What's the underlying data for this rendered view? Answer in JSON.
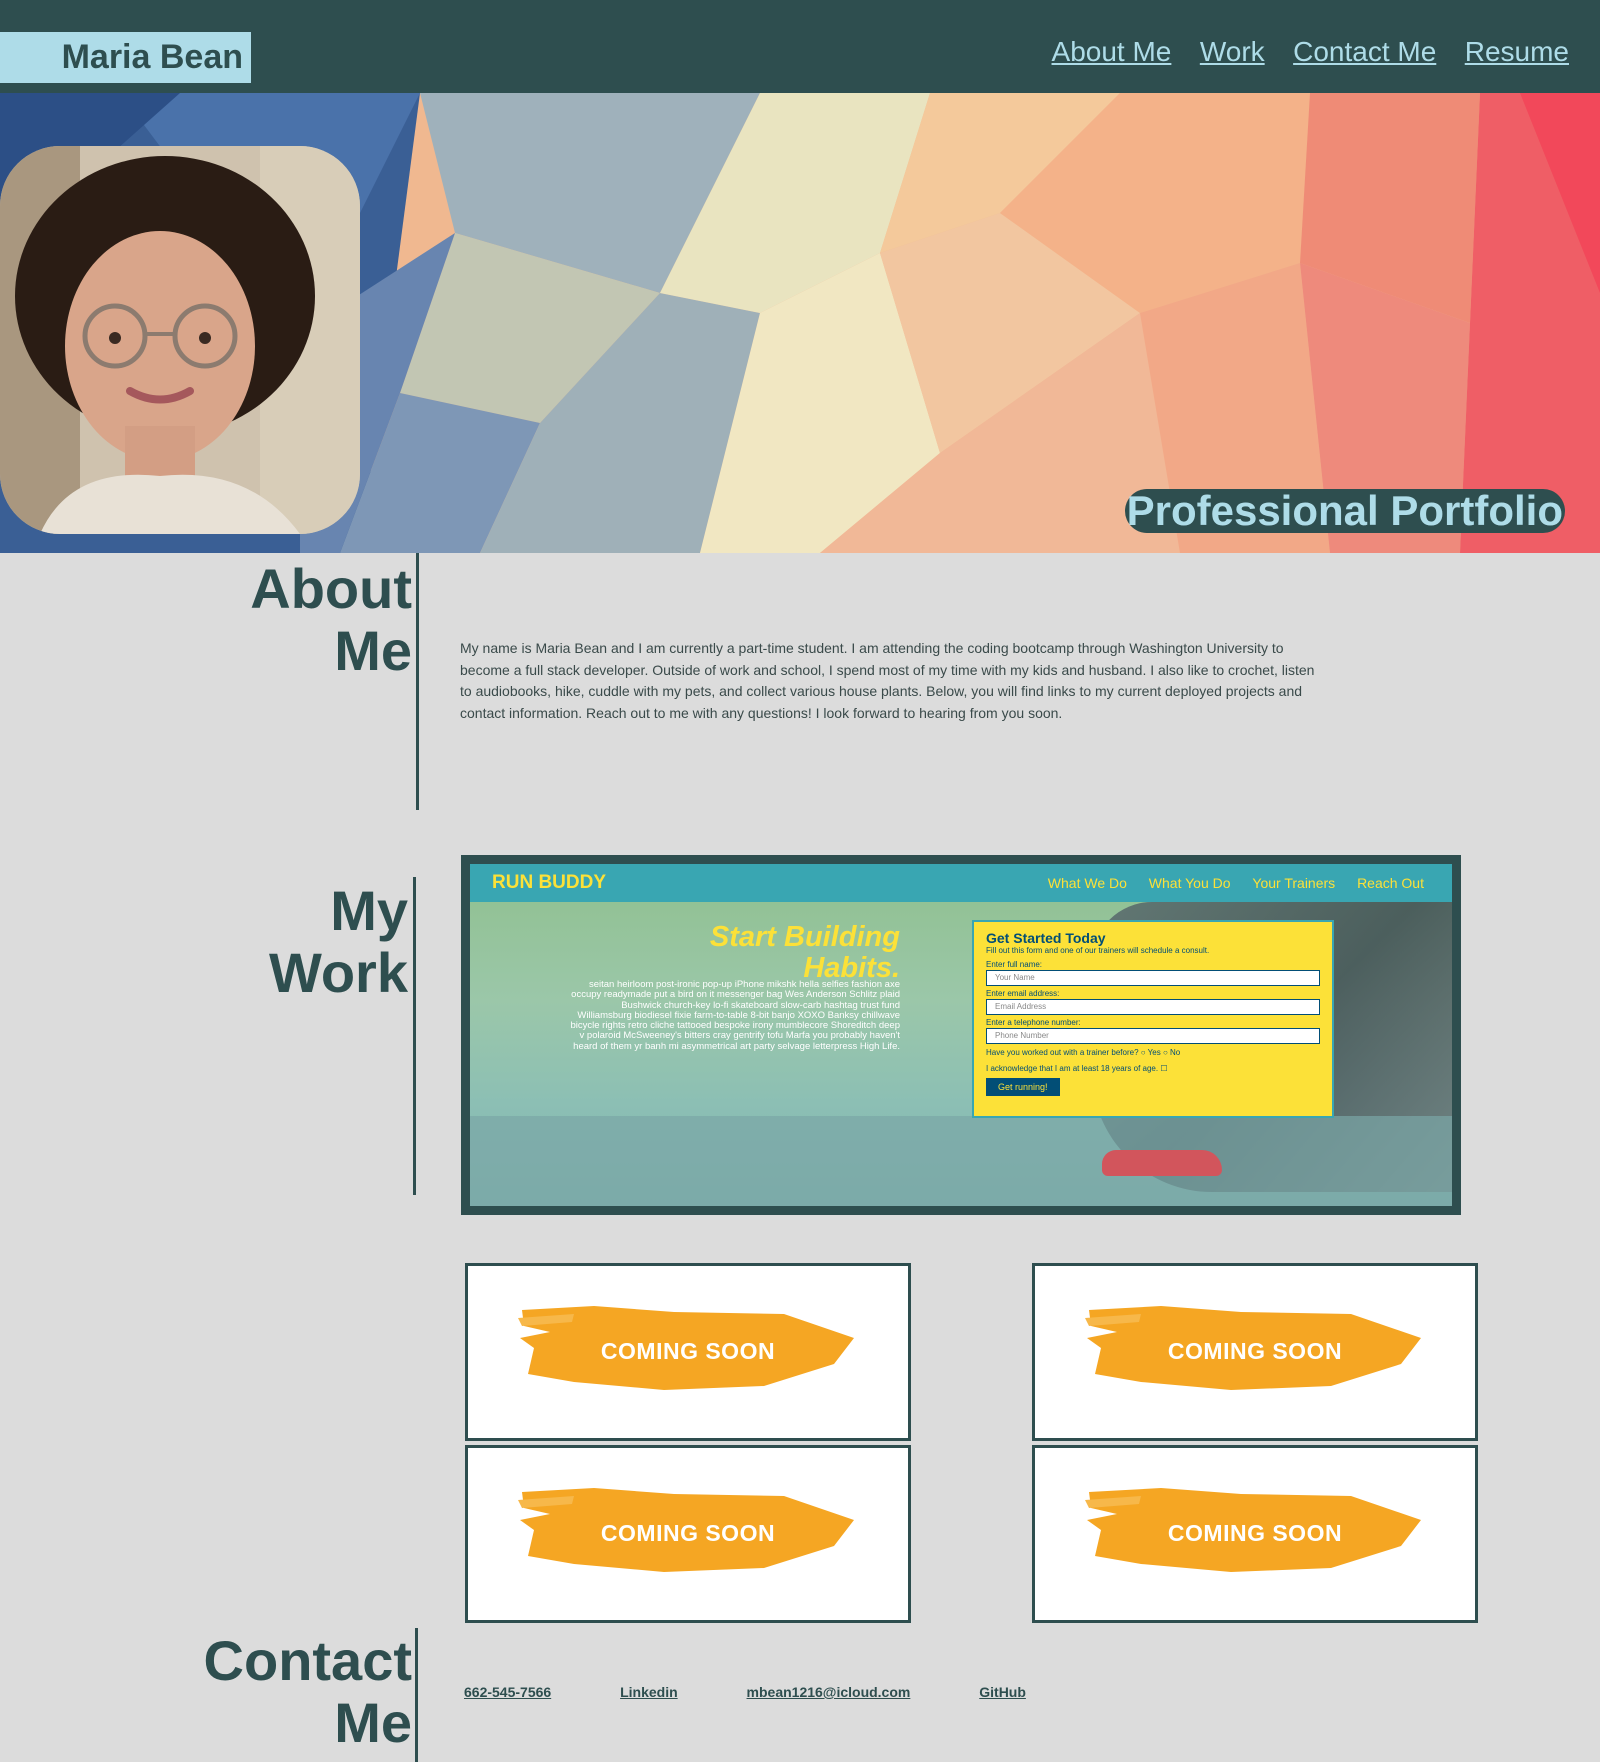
{
  "header": {
    "brand": "Maria Bean",
    "nav": [
      "About Me",
      "Work",
      "Contact Me",
      "Resume"
    ]
  },
  "hero": {
    "title": "Professional Portfolio"
  },
  "about": {
    "title_line1": "About",
    "title_line2": "Me",
    "text": "My name is Maria Bean and I am currently a part-time student. I am attending the coding bootcamp through Washington University to become a full stack developer. Outside of work and school, I spend most of my time with my kids and husband. I also like to crochet, listen to audiobooks, hike, cuddle with my pets, and collect various house plants. Below, you will find links to my current deployed projects and contact information. Reach out to me with any questions! I look forward to hearing from you soon."
  },
  "work": {
    "title_line1": "My",
    "title_line2": "Work",
    "showcase": {
      "logo": "RUN BUDDY",
      "nav": [
        "What We Do",
        "What You Do",
        "Your Trainers",
        "Reach Out"
      ],
      "headline_line1": "Start Building",
      "headline_line2": "Habits.",
      "body": "seitan heirloom post-ironic pop-up iPhone mikshk hella selfies fashion axe occupy readymade put a bird on it messenger bag Wes Anderson Schlitz plaid Bushwick church-key lo-fi skateboard slow-carb hashtag trust fund Williamsburg biodiesel fixie farm-to-table 8-bit banjo XOXO Banksy chillwave bicycle rights retro cliche tattooed bespoke irony mumblecore Shoreditch deep v polaroid McSweeney's bitters cray gentrify tofu Marfa you probably haven't heard of them yr banh mi asymmetrical art party selvage letterpress High Life.",
      "form": {
        "title": "Get Started Today",
        "subtitle": "Fill out this form and one of our trainers will schedule a consult.",
        "name_label": "Enter full name:",
        "name_placeholder": "Your Name",
        "email_label": "Enter email address:",
        "email_placeholder": "Email Address",
        "phone_label": "Enter a telephone number:",
        "phone_placeholder": "Phone Number",
        "question": "Have you worked out with a trainer before?",
        "yes": "Yes",
        "no": "No",
        "acknowledge": "I acknowledge that I am at least 18 years of age.",
        "button": "Get running!"
      }
    },
    "coming_soon": [
      "COMING SOON",
      "COMING SOON",
      "COMING SOON",
      "COMING SOON"
    ]
  },
  "contact": {
    "title_line1": "Contact",
    "title_line2": "Me",
    "links": [
      "662-545-7566",
      "Linkedin",
      "mbean1216@icloud.com",
      "GitHub"
    ]
  },
  "colors": {
    "header": "#2e4e4f",
    "accent": "#aedce8",
    "background": "#dcdcdc",
    "runbuddy_teal": "#39a6b2",
    "runbuddy_yellow": "#fce138",
    "coming_soon_orange": "#f5a623"
  }
}
